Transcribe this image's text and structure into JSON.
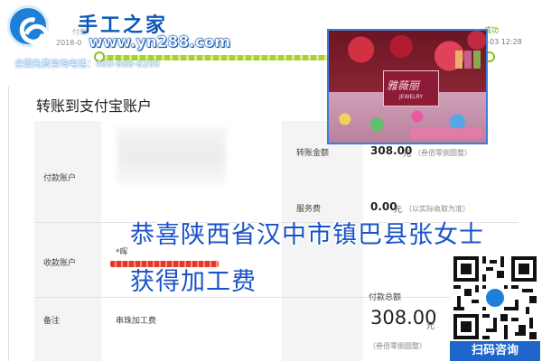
{
  "watermark": {
    "brand_title": "手工之家",
    "brand_url": "www.yn288.com",
    "hotline": "全国免费咨询电话：400-888-8200"
  },
  "progress": {
    "status_text": "成功",
    "status_time": "1-03 12:28",
    "ghost_step": "付款",
    "ghost_date": "2018-0",
    "ghost_time": "2:"
  },
  "page": {
    "heading": "转账到支付宝账户"
  },
  "form": {
    "payer_label": "付款账户",
    "payee_label": "收款账户",
    "payee_value": "*晖",
    "remark_label": "备注",
    "remark_value": "串珠加工费",
    "transfer_label": "转账金额",
    "transfer_amount": "308.00",
    "transfer_unit": "元",
    "transfer_hint": "（叁佰零捌圆整）",
    "fee_label": "服务费",
    "fee_amount": "0.00",
    "fee_unit": "元",
    "fee_hint": "（以实际收取为准）",
    "total_label": "付款总额",
    "total_amount": "308.00",
    "total_unit": "元",
    "total_hint": "（叁佰零捌圆整）"
  },
  "product_photo": {
    "brand_text": "雅薇丽",
    "sub_text": "JEWELRY"
  },
  "overlay": {
    "line1": "恭喜陕西省汉中市镇巴县张女士",
    "line2": "获得加工费"
  },
  "qr": {
    "label": "扫码咨询"
  },
  "colors": {
    "brand_blue": "#1e7fd8",
    "overlay_blue": "#1a53c8",
    "progress_green": "#a9d22a"
  }
}
